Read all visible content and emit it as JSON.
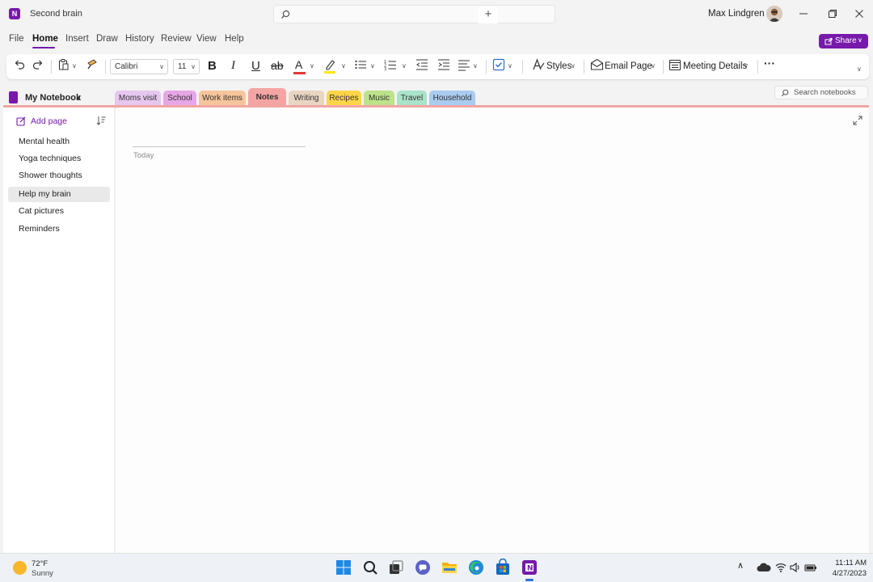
{
  "window": {
    "title": "Second brain",
    "app_icon_letter": "N"
  },
  "user": {
    "name": "Max Lindgren"
  },
  "menu": {
    "items": [
      "File",
      "Home",
      "Insert",
      "Draw",
      "History",
      "Review",
      "View",
      "Help"
    ],
    "active": "Home",
    "share_label": "Share"
  },
  "ribbon": {
    "font_name": "Calibri",
    "font_size": "11",
    "bold": "B",
    "italic": "I",
    "underline": "U",
    "strike": "ab",
    "font_color_letter": "A",
    "styles_label": "Styles",
    "email_label": "Email Page",
    "meeting_label": "Meeting Details",
    "more_label": "···",
    "colors": {
      "font_color": "#e53935",
      "highlight": "#ffe600",
      "accent": "#7719aa"
    }
  },
  "notebook": {
    "name": "My Notebook",
    "search_placeholder": "Search notebooks",
    "sections": [
      {
        "label": "Moms visit",
        "color": "#e6c7ef"
      },
      {
        "label": "School",
        "color": "#e6a6e6"
      },
      {
        "label": "Work items",
        "color": "#f7c59b"
      },
      {
        "label": "Notes",
        "color": "#f4a5a3",
        "active": true
      },
      {
        "label": "Writing",
        "color": "#e8d5c2"
      },
      {
        "label": "Recipes",
        "color": "#ffd54a"
      },
      {
        "label": "Music",
        "color": "#bde38a"
      },
      {
        "label": "Travel",
        "color": "#a9e3c9"
      },
      {
        "label": "Household",
        "color": "#a9cbf0"
      }
    ],
    "add_section_label": "+"
  },
  "pages": {
    "add_label": "Add page",
    "items": [
      "Mental health",
      "Yoga techniques",
      "Shower thoughts",
      "Help my brain",
      "Cat pictures",
      "Reminders"
    ],
    "selected": "Help my brain"
  },
  "page": {
    "date": "Today"
  },
  "taskbar": {
    "weather_temp": "72°F",
    "weather_cond": "Sunny",
    "time": "11:11 AM",
    "date": "4/27/2023",
    "apps": [
      "start-icon",
      "search-icon",
      "task-view-icon",
      "teams-chat-icon",
      "file-explorer-icon",
      "edge-icon",
      "store-icon",
      "onenote-icon"
    ]
  }
}
